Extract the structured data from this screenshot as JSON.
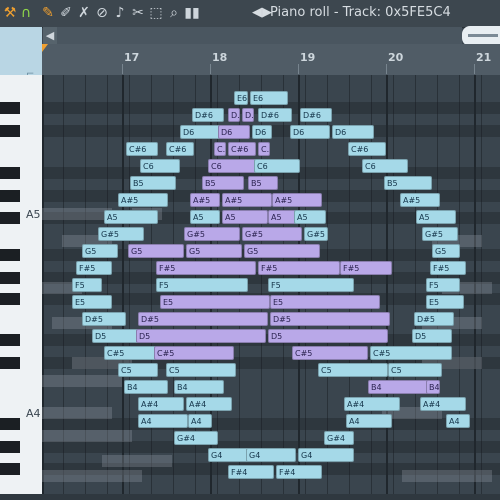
{
  "toolbar": {
    "icons": [
      "wrench-icon",
      "magnet-icon",
      "pencil-icon",
      "paint-icon",
      "delete-icon",
      "mute-icon",
      "mute-speaker-icon",
      "slice-icon",
      "select-icon",
      "zoom-icon",
      "playback-icon"
    ],
    "title_arrow": "◀▶",
    "title": "Piano roll - Track: 0x5FE5C4",
    "accent": "#f0a030"
  },
  "timeline": {
    "bars": [
      "17",
      "18",
      "19",
      "20",
      "21"
    ]
  },
  "keyboard": {
    "labels": [
      "A5",
      "A4"
    ]
  },
  "colors": {
    "note_blue": "#a5d9e8",
    "note_purple": "#b9a8e8",
    "grid_bg": "#3a454e"
  },
  "notes": [
    {
      "l": "E6",
      "c": "b"
    },
    {
      "l": "E6",
      "c": "b"
    },
    {
      "l": "D#6",
      "c": "b"
    },
    {
      "l": "D.",
      "c": "p"
    },
    {
      "l": "D.",
      "c": "p"
    },
    {
      "l": "D#6",
      "c": "b"
    },
    {
      "l": "D#6",
      "c": "b"
    },
    {
      "l": "D6",
      "c": "b"
    },
    {
      "l": "D6",
      "c": "p"
    },
    {
      "l": "D6",
      "c": "b"
    },
    {
      "l": "D6",
      "c": "b"
    },
    {
      "l": "D6",
      "c": "b"
    },
    {
      "l": "C#6",
      "c": "b"
    },
    {
      "l": "C#6",
      "c": "b"
    },
    {
      "l": "C.",
      "c": "p"
    },
    {
      "l": "C#6",
      "c": "p"
    },
    {
      "l": "C.",
      "c": "p"
    },
    {
      "l": "C#6",
      "c": "b"
    },
    {
      "l": "C6",
      "c": "b"
    },
    {
      "l": "C6",
      "c": "p"
    },
    {
      "l": "C6",
      "c": "b"
    },
    {
      "l": "C6",
      "c": "b"
    },
    {
      "l": "B5",
      "c": "b"
    },
    {
      "l": "B5",
      "c": "p"
    },
    {
      "l": "B5",
      "c": "p"
    },
    {
      "l": "B5",
      "c": "b"
    },
    {
      "l": "A#5",
      "c": "b"
    },
    {
      "l": "A#5",
      "c": "p"
    },
    {
      "l": "A#5",
      "c": "p"
    },
    {
      "l": "A#5",
      "c": "p"
    },
    {
      "l": "A#5",
      "c": "b"
    },
    {
      "l": "A5",
      "c": "b"
    },
    {
      "l": "A5",
      "c": "b"
    },
    {
      "l": "A5",
      "c": "p"
    },
    {
      "l": "A5",
      "c": "p"
    },
    {
      "l": "A5",
      "c": "b"
    },
    {
      "l": "A5",
      "c": "b"
    },
    {
      "l": "G#5",
      "c": "b"
    },
    {
      "l": "G#5",
      "c": "p"
    },
    {
      "l": "G#5",
      "c": "p"
    },
    {
      "l": "G#5",
      "c": "b"
    },
    {
      "l": "G#5",
      "c": "b"
    },
    {
      "l": "G5",
      "c": "b"
    },
    {
      "l": "G5",
      "c": "p"
    },
    {
      "l": "G5",
      "c": "p"
    },
    {
      "l": "G5",
      "c": "p"
    },
    {
      "l": "G5",
      "c": "b"
    },
    {
      "l": "F#5",
      "c": "b"
    },
    {
      "l": "F#5",
      "c": "p"
    },
    {
      "l": "F#5",
      "c": "p"
    },
    {
      "l": "F#5",
      "c": "p"
    },
    {
      "l": "F#5",
      "c": "b"
    },
    {
      "l": "F5",
      "c": "b"
    },
    {
      "l": "F5",
      "c": "b"
    },
    {
      "l": "F5",
      "c": "b"
    },
    {
      "l": "F5",
      "c": "b"
    },
    {
      "l": "E5",
      "c": "b"
    },
    {
      "l": "E5",
      "c": "p"
    },
    {
      "l": "E5",
      "c": "p"
    },
    {
      "l": "E5",
      "c": "b"
    },
    {
      "l": "D#5",
      "c": "b"
    },
    {
      "l": "D#5",
      "c": "p"
    },
    {
      "l": "D#5",
      "c": "p"
    },
    {
      "l": "D#5",
      "c": "b"
    },
    {
      "l": "D5",
      "c": "b"
    },
    {
      "l": "D5",
      "c": "p"
    },
    {
      "l": "D5",
      "c": "p"
    },
    {
      "l": "D5",
      "c": "b"
    },
    {
      "l": "C#5",
      "c": "b"
    },
    {
      "l": "C#5",
      "c": "p"
    },
    {
      "l": "C#5",
      "c": "p"
    },
    {
      "l": "C#5",
      "c": "b"
    },
    {
      "l": "C5",
      "c": "b"
    },
    {
      "l": "C5",
      "c": "b"
    },
    {
      "l": "C5",
      "c": "b"
    },
    {
      "l": "C5",
      "c": "b"
    },
    {
      "l": "B4",
      "c": "b"
    },
    {
      "l": "B4",
      "c": "b"
    },
    {
      "l": "B4",
      "c": "p"
    },
    {
      "l": "B4",
      "c": "p"
    },
    {
      "l": "A#4",
      "c": "b"
    },
    {
      "l": "A#4",
      "c": "b"
    },
    {
      "l": "A#4",
      "c": "b"
    },
    {
      "l": "A#4",
      "c": "b"
    },
    {
      "l": "A4",
      "c": "b"
    },
    {
      "l": "A4",
      "c": "b"
    },
    {
      "l": "A4",
      "c": "b"
    },
    {
      "l": "A4",
      "c": "b"
    },
    {
      "l": "G#4",
      "c": "b"
    },
    {
      "l": "G#4",
      "c": "b"
    },
    {
      "l": "G4",
      "c": "b"
    },
    {
      "l": "G4",
      "c": "b"
    },
    {
      "l": "G4",
      "c": "b"
    },
    {
      "l": "F#4",
      "c": "b"
    },
    {
      "l": "F#4",
      "c": "b"
    }
  ]
}
